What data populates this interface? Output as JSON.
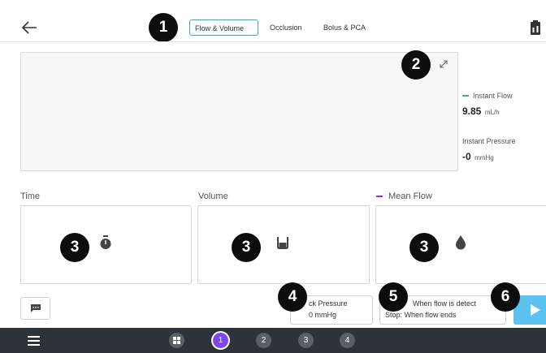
{
  "header": {
    "tabs": [
      {
        "label": "Flow & Volume"
      },
      {
        "label": "Occlusion"
      },
      {
        "label": "Bolus & PCA"
      }
    ]
  },
  "callouts": [
    "1",
    "2",
    "3",
    "3",
    "3",
    "4",
    "5",
    "6"
  ],
  "readings": {
    "instant_flow_label": "Instant Flow",
    "instant_flow_value": "9.85",
    "instant_flow_unit": "mL/h",
    "instant_pressure_label": "Instant Pressure",
    "instant_pressure_value": "-0",
    "instant_pressure_unit": "mmHg"
  },
  "cards": [
    {
      "label": "Time",
      "icon": "stopwatch-icon"
    },
    {
      "label": "Volume",
      "icon": "beaker-icon"
    },
    {
      "label": "Mean Flow",
      "icon": "droplet-icon"
    }
  ],
  "actions": {
    "back_pressure_line1": "ck Pressure",
    "back_pressure_line2": "0 mmHg",
    "flow_detect_line1": "When flow is detect",
    "flow_detect_line2": "Stop: When flow ends"
  },
  "bottom_nav": {
    "steps": [
      "1",
      "2",
      "3",
      "4"
    ]
  },
  "colors": {
    "accent": "#2bb3b8",
    "legend_mean": "#a020f0",
    "active_step": "#7b47e8",
    "play": "#5cc3f1"
  }
}
